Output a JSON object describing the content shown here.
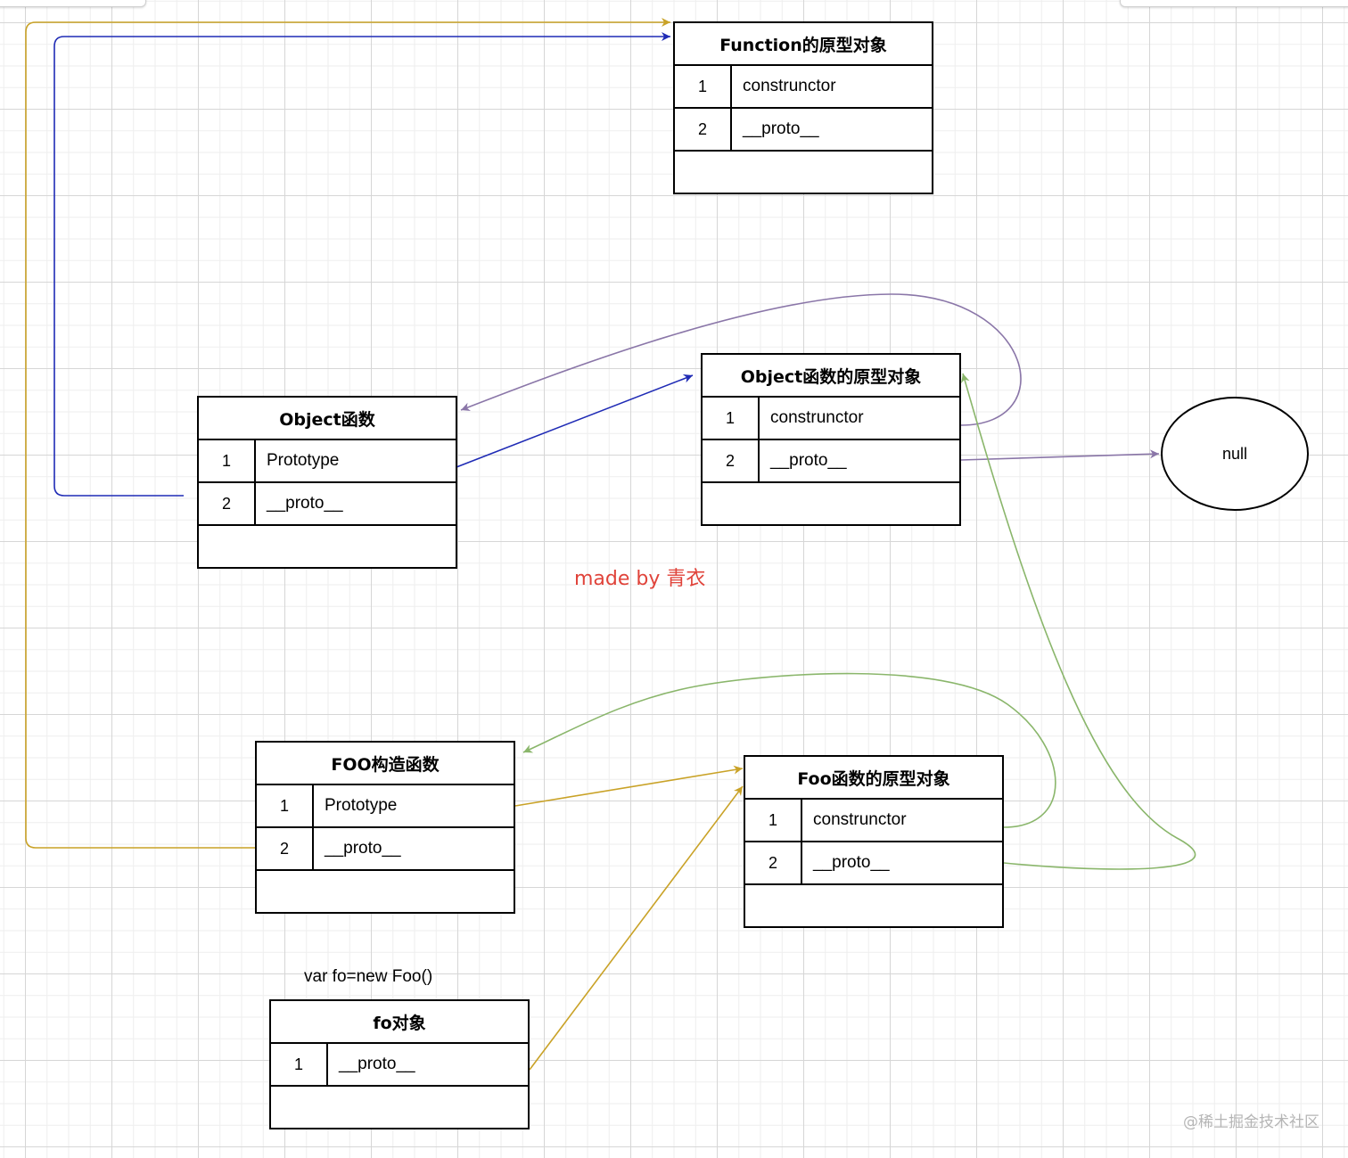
{
  "colors": {
    "yellow_link": "#c9a227",
    "blue_link": "#1f2bb5",
    "purple_link": "#8a76a8",
    "green_link": "#8ab66b",
    "credit": "#e0433a"
  },
  "function_proto": {
    "title": "Function的原型对象",
    "rows": [
      {
        "index": "1",
        "field": "construnctor"
      },
      {
        "index": "2",
        "field": "__proto__"
      }
    ]
  },
  "object_fn": {
    "title": "Object函数",
    "rows": [
      {
        "index": "1",
        "field": "Prototype"
      },
      {
        "index": "2",
        "field": "__proto__"
      }
    ]
  },
  "object_proto": {
    "title": "Object函数的原型对象",
    "rows": [
      {
        "index": "1",
        "field": "construnctor"
      },
      {
        "index": "2",
        "field": "__proto__"
      }
    ]
  },
  "null_node": {
    "label": "null"
  },
  "foo_ctor": {
    "title": "FOO构造函数",
    "rows": [
      {
        "index": "1",
        "field": "Prototype"
      },
      {
        "index": "2",
        "field": "__proto__"
      }
    ]
  },
  "foo_proto": {
    "title": "Foo函数的原型对象",
    "rows": [
      {
        "index": "1",
        "field": "construnctor"
      },
      {
        "index": "2",
        "field": "__proto__"
      }
    ]
  },
  "fo_label": "var fo=new Foo()",
  "fo_obj": {
    "title": "fo对象",
    "rows": [
      {
        "index": "1",
        "field": "__proto__"
      }
    ]
  },
  "credit": "made by 青衣",
  "watermark": "@稀土掘金技术社区"
}
